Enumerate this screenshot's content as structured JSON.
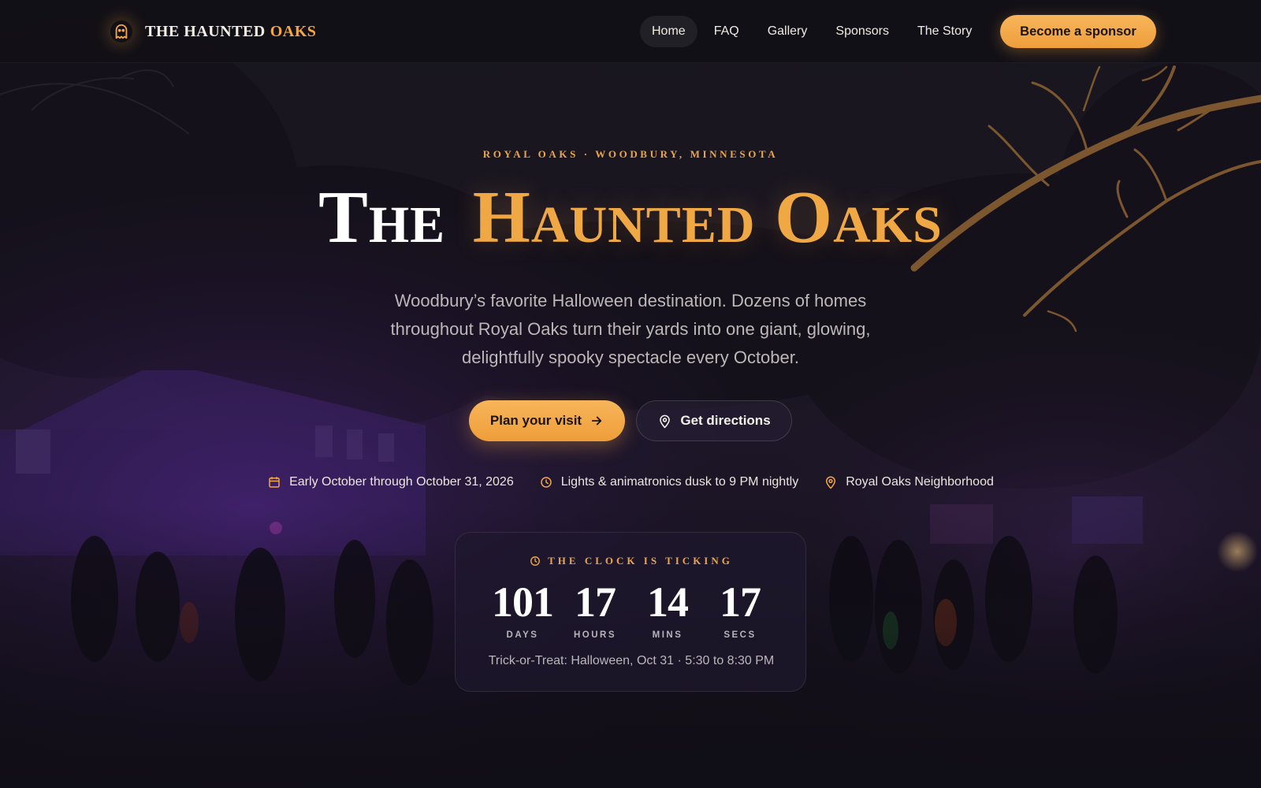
{
  "brand": {
    "name": "THE HAUNTED",
    "accent": "OAKS",
    "icon": "ghost-icon"
  },
  "nav": {
    "links": [
      {
        "label": "Home",
        "active": true
      },
      {
        "label": "FAQ",
        "active": false
      },
      {
        "label": "Gallery",
        "active": false
      },
      {
        "label": "Sponsors",
        "active": false
      },
      {
        "label": "The Story",
        "active": false
      }
    ],
    "cta_label": "Become a sponsor"
  },
  "hero": {
    "eyebrow": "ROYAL OAKS · WOODBURY, MINNESOTA",
    "title_part1": "The",
    "title_part2": "Haunted Oaks",
    "subtitle": "Woodbury’s favorite Halloween destination. Dozens of homes throughout Royal Oaks turn their yards into one giant, glowing, delightfully spooky spectacle every October.",
    "primary_button": {
      "label": "Plan your visit",
      "icon": "arrow-right-icon"
    },
    "secondary_button": {
      "label": "Get directions",
      "icon": "map-pin-icon"
    },
    "facts": [
      {
        "icon": "calendar-icon",
        "text": "Early October through October 31, 2026"
      },
      {
        "icon": "clock-icon",
        "text": "Lights & animatronics dusk to 9 PM nightly"
      },
      {
        "icon": "map-pin-icon",
        "text": "Royal Oaks Neighborhood"
      }
    ]
  },
  "countdown": {
    "label": "THE CLOCK IS TICKING",
    "icon": "clock-icon",
    "units": [
      {
        "value": "101",
        "caption": "DAYS"
      },
      {
        "value": "17",
        "caption": "HOURS"
      },
      {
        "value": "14",
        "caption": "MINS"
      },
      {
        "value": "17",
        "caption": "SECS"
      }
    ],
    "footnote": "Trick-or-Treat: Halloween, Oct 31 · 5:30 to 8:30 PM"
  },
  "colors": {
    "accent": "#f3a745",
    "background": "#120f17",
    "purple_glow": "#5a2a9a"
  }
}
